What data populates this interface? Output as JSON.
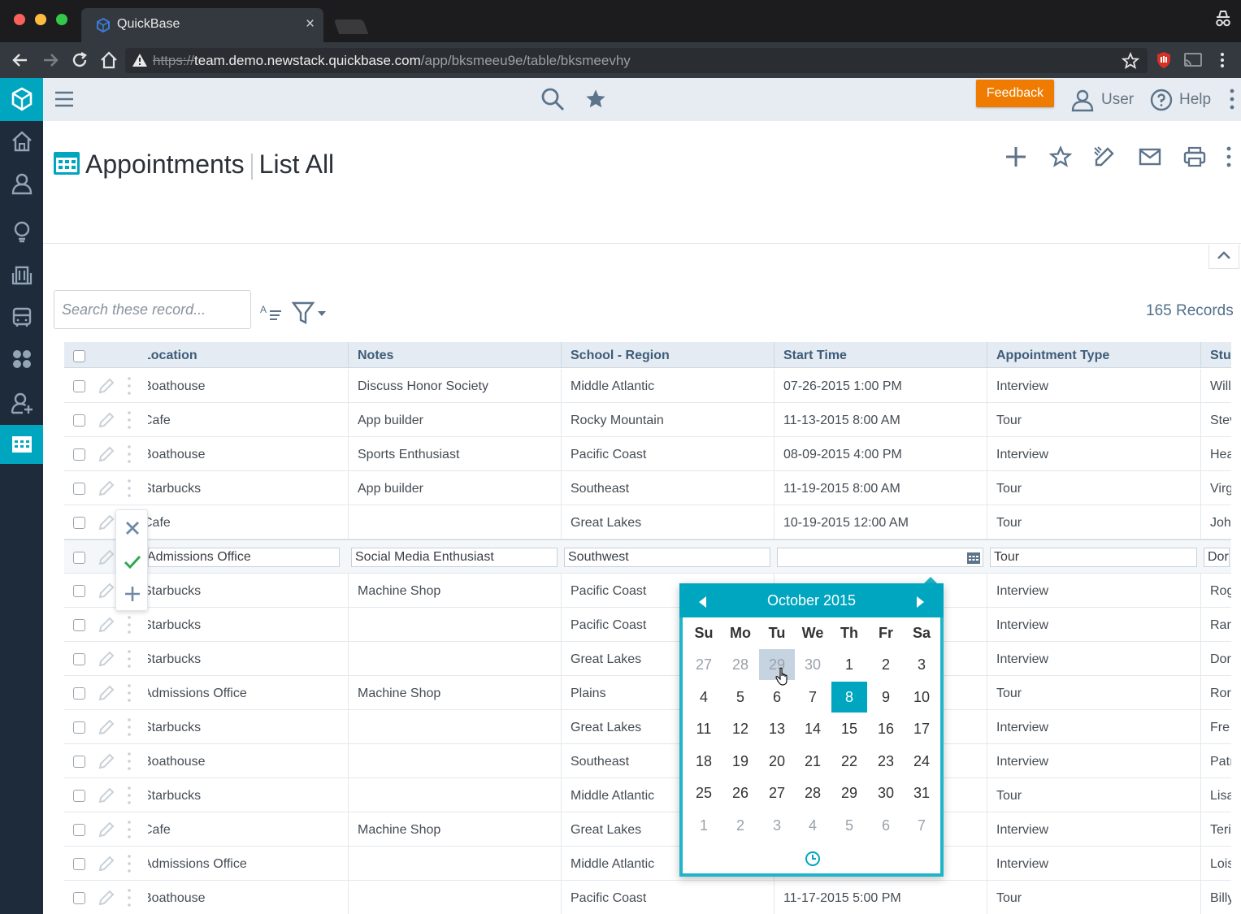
{
  "browser": {
    "tab_title": "QuickBase",
    "url_protocol": "https://",
    "url_host": "team.demo.newstack.quickbase.com",
    "url_path": "/app/bksmeeu9e/table/bksmeevhy"
  },
  "topbar": {
    "feedback_label": "Feedback",
    "user_label": "User",
    "help_label": "Help"
  },
  "page": {
    "table_name": "Appointments",
    "report_name": "List All",
    "search_placeholder": "Search these record...",
    "record_count": "165 Records"
  },
  "grid": {
    "columns": [
      "Location",
      "Notes",
      "School - Region",
      "Start Time",
      "Appointment Type",
      "Student"
    ],
    "rows": [
      {
        "location": "Boathouse",
        "notes": "Discuss Honor Society",
        "region": "Middle Atlantic",
        "start": "07-26-2015 1:00 PM",
        "type": "Interview",
        "student": "Will"
      },
      {
        "location": "Cafe",
        "notes": "App builder",
        "region": "Rocky Mountain",
        "start": "11-13-2015 8:00 AM",
        "type": "Tour",
        "student": "Stev"
      },
      {
        "location": "Boathouse",
        "notes": "Sports Enthusiast",
        "region": "Pacific Coast",
        "start": "08-09-2015 4:00 PM",
        "type": "Interview",
        "student": "Hea"
      },
      {
        "location": "Starbucks",
        "notes": "App builder",
        "region": "Southeast",
        "start": "11-19-2015 8:00 AM",
        "type": "Tour",
        "student": "Virg"
      },
      {
        "location": "Cafe",
        "notes": "",
        "region": "Great Lakes",
        "start": "10-19-2015 12:00 AM",
        "type": "Tour",
        "student": "John"
      },
      {
        "location": "Admissions Office",
        "notes": "Social Media Enthusiast",
        "region": "Southwest",
        "start": "",
        "type": "Tour",
        "student": "Dore"
      },
      {
        "location": "Starbucks",
        "notes": "Machine Shop",
        "region": "Pacific Coast",
        "start": "",
        "type": "Interview",
        "student": "Rog"
      },
      {
        "location": "Starbucks",
        "notes": "",
        "region": "Pacific Coast",
        "start": "",
        "type": "Interview",
        "student": "Ran"
      },
      {
        "location": "Starbucks",
        "notes": "",
        "region": "Great Lakes",
        "start": "",
        "type": "Interview",
        "student": "Dor"
      },
      {
        "location": "Admissions Office",
        "notes": "Machine Shop",
        "region": "Plains",
        "start": "",
        "type": "Tour",
        "student": "Ror"
      },
      {
        "location": "Starbucks",
        "notes": "",
        "region": "Great Lakes",
        "start": "",
        "type": "Interview",
        "student": "Fre"
      },
      {
        "location": "Boathouse",
        "notes": "",
        "region": "Southeast",
        "start": "",
        "type": "Interview",
        "student": "Patı"
      },
      {
        "location": "Starbucks",
        "notes": "",
        "region": "Middle Atlantic",
        "start": "",
        "type": "Tour",
        "student": "Lisa"
      },
      {
        "location": "Cafe",
        "notes": "Machine Shop",
        "region": "Great Lakes",
        "start": "",
        "type": "Interview",
        "student": "Teri"
      },
      {
        "location": "Admissions Office",
        "notes": "",
        "region": "Middle Atlantic",
        "start": "",
        "type": "Interview",
        "student": "Lois"
      },
      {
        "location": "Boathouse",
        "notes": "",
        "region": "Pacific Coast",
        "start": "11-17-2015 5:00 PM",
        "type": "Tour",
        "student": "Billy"
      }
    ],
    "editing_row_index": 5
  },
  "calendar": {
    "month_label": "October 2015",
    "weekdays": [
      "Su",
      "Mo",
      "Tu",
      "We",
      "Th",
      "Fr",
      "Sa"
    ],
    "weeks": [
      [
        "27",
        "28",
        "29",
        "30",
        "1",
        "2",
        "3"
      ],
      [
        "4",
        "5",
        "6",
        "7",
        "8",
        "9",
        "10"
      ],
      [
        "11",
        "12",
        "13",
        "14",
        "15",
        "16",
        "17"
      ],
      [
        "18",
        "19",
        "20",
        "21",
        "22",
        "23",
        "24"
      ],
      [
        "25",
        "26",
        "27",
        "28",
        "29",
        "30",
        "31"
      ],
      [
        "1",
        "2",
        "3",
        "4",
        "5",
        "6",
        "7"
      ]
    ],
    "selected_day": "8",
    "hovered_day": "29"
  },
  "colors": {
    "accent": "#00a6c0",
    "feedback": "#ef7c00",
    "rail": "#1e2b3a"
  }
}
